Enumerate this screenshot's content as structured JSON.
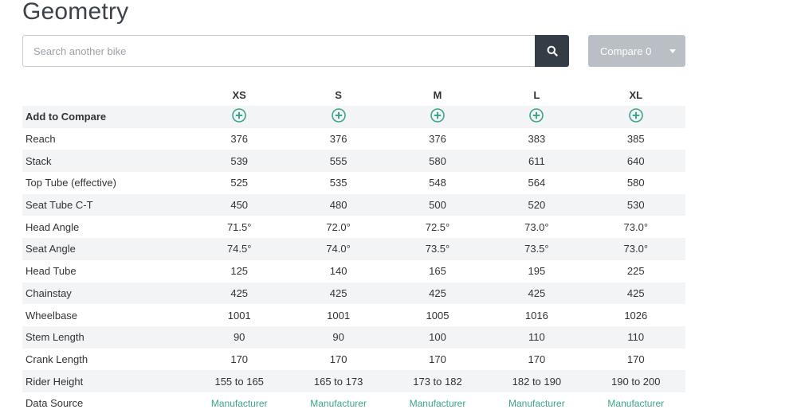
{
  "page": {
    "title": "Geometry"
  },
  "search": {
    "placeholder": "Search another bike",
    "button_icon": "search-icon"
  },
  "compare": {
    "label": "Compare 0",
    "caret_icon": "caret-down-icon"
  },
  "colors": {
    "accent": "#3aa58b",
    "search_button": "#343d46",
    "compare_button": "#b9bfc4"
  },
  "table": {
    "sizes": [
      "XS",
      "S",
      "M",
      "L",
      "XL"
    ],
    "add_to_compare_label": "Add to Compare",
    "rows": [
      {
        "label": "Reach",
        "values": [
          "376",
          "376",
          "376",
          "383",
          "385"
        ]
      },
      {
        "label": "Stack",
        "values": [
          "539",
          "555",
          "580",
          "611",
          "640"
        ]
      },
      {
        "label": "Top Tube (effective)",
        "values": [
          "525",
          "535",
          "548",
          "564",
          "580"
        ]
      },
      {
        "label": "Seat Tube C-T",
        "values": [
          "450",
          "480",
          "500",
          "520",
          "530"
        ]
      },
      {
        "label": "Head Angle",
        "values": [
          "71.5°",
          "72.0°",
          "72.5°",
          "73.0°",
          "73.0°"
        ]
      },
      {
        "label": "Seat Angle",
        "values": [
          "74.5°",
          "74.0°",
          "73.5°",
          "73.5°",
          "73.0°"
        ]
      },
      {
        "label": "Head Tube",
        "values": [
          "125",
          "140",
          "165",
          "195",
          "225"
        ]
      },
      {
        "label": "Chainstay",
        "values": [
          "425",
          "425",
          "425",
          "425",
          "425"
        ]
      },
      {
        "label": "Wheelbase",
        "values": [
          "1001",
          "1001",
          "1005",
          "1016",
          "1026"
        ]
      },
      {
        "label": "Stem Length",
        "values": [
          "90",
          "90",
          "100",
          "110",
          "110"
        ]
      },
      {
        "label": "Crank Length",
        "values": [
          "170",
          "170",
          "170",
          "170",
          "170"
        ]
      },
      {
        "label": "Rider Height",
        "values": [
          "155 to 165",
          "165 to 173",
          "173 to 182",
          "182 to 190",
          "190 to 200"
        ]
      }
    ],
    "data_source": {
      "label": "Data Source",
      "values": [
        "Manufacturer",
        "Manufacturer",
        "Manufacturer",
        "Manufacturer",
        "Manufacturer"
      ]
    }
  }
}
